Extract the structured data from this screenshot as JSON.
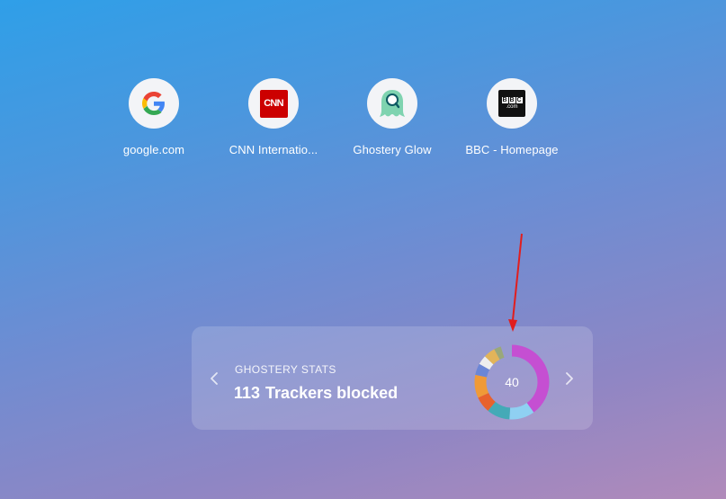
{
  "shortcuts": [
    {
      "label": "google.com",
      "icon": "google-icon"
    },
    {
      "label": "CNN Internatio...",
      "icon": "cnn-icon",
      "logo_text": "CNN"
    },
    {
      "label": "Ghostery Glow",
      "icon": "ghostery-glow-icon"
    },
    {
      "label": "BBC - Homepage",
      "icon": "bbc-icon",
      "logo_letters": [
        "B",
        "B",
        "C"
      ],
      "logo_sub": ".com"
    }
  ],
  "stats": {
    "kicker": "GHOSTERY STATS",
    "tracker_count": "113",
    "tracker_label": "Trackers blocked",
    "donut_value": "40",
    "donut_segments": [
      {
        "color": "#c54fd2",
        "fraction": 0.4
      },
      {
        "color": "#8fd0f2",
        "fraction": 0.11
      },
      {
        "color": "#44aab7",
        "fraction": 0.1
      },
      {
        "color": "#e8622d",
        "fraction": 0.07
      },
      {
        "color": "#f09a37",
        "fraction": 0.1
      },
      {
        "color": "#6b86d6",
        "fraction": 0.05
      },
      {
        "color": "#eeeeee",
        "fraction": 0.04
      },
      {
        "color": "#e2b45a",
        "fraction": 0.05
      },
      {
        "color": "#9aa87a",
        "fraction": 0.03
      }
    ]
  },
  "colors": {
    "annotation_arrow": "#e11e1e",
    "cnn_red": "#cc0000",
    "ghostery_green": "#7fd3b0"
  }
}
